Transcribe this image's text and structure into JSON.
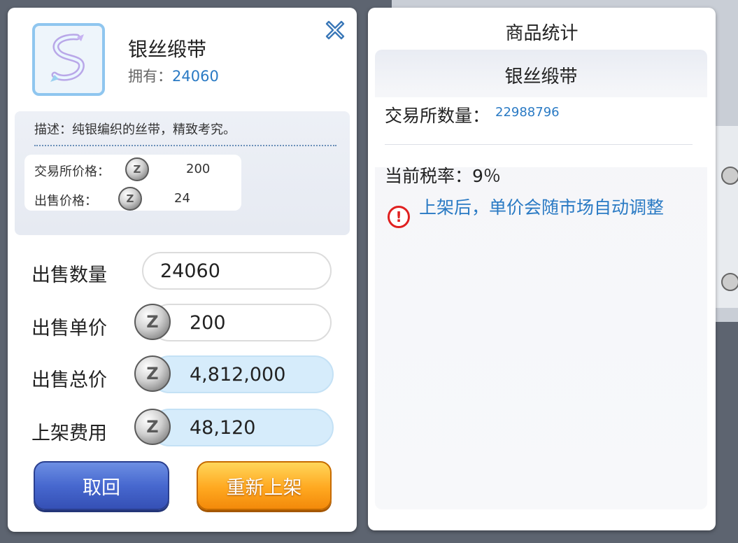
{
  "item": {
    "name": "银丝缎带",
    "owned_label": "拥有：",
    "owned_value": "24060",
    "icon": "silver-ribbon-icon",
    "description": "描述：纯银编织的丝带，精致考究。",
    "exchange_price_label": "交易所价格：",
    "exchange_price_value": "200",
    "sell_price_label": "出售价格：",
    "sell_price_value": "24"
  },
  "form": {
    "quantity_label": "出售数量",
    "quantity_value": "24060",
    "unit_price_label": "出售单价",
    "unit_price_value": "200",
    "total_price_label": "出售总价",
    "total_price_value": "4,812,000",
    "listing_fee_label": "上架费用",
    "listing_fee_value": "48,120"
  },
  "buttons": {
    "cancel_label": "取回",
    "relist_label": "重新上架",
    "close_icon": "close-icon"
  },
  "stats": {
    "title": "商品统计",
    "item_name": "银丝缎带",
    "exchange_qty_label": "交易所数量：",
    "exchange_qty_value": "22988796",
    "tax_rate_text": "当前税率：9％",
    "warning_text": "上架后，单价会随市场自动调整"
  },
  "colors": {
    "accent_blue": "#2a7ac4",
    "cancel_button": "#4768cf",
    "relist_button": "#ffa820",
    "warning_red": "#e02020"
  },
  "currency_icon": "zeny-coin-icon"
}
